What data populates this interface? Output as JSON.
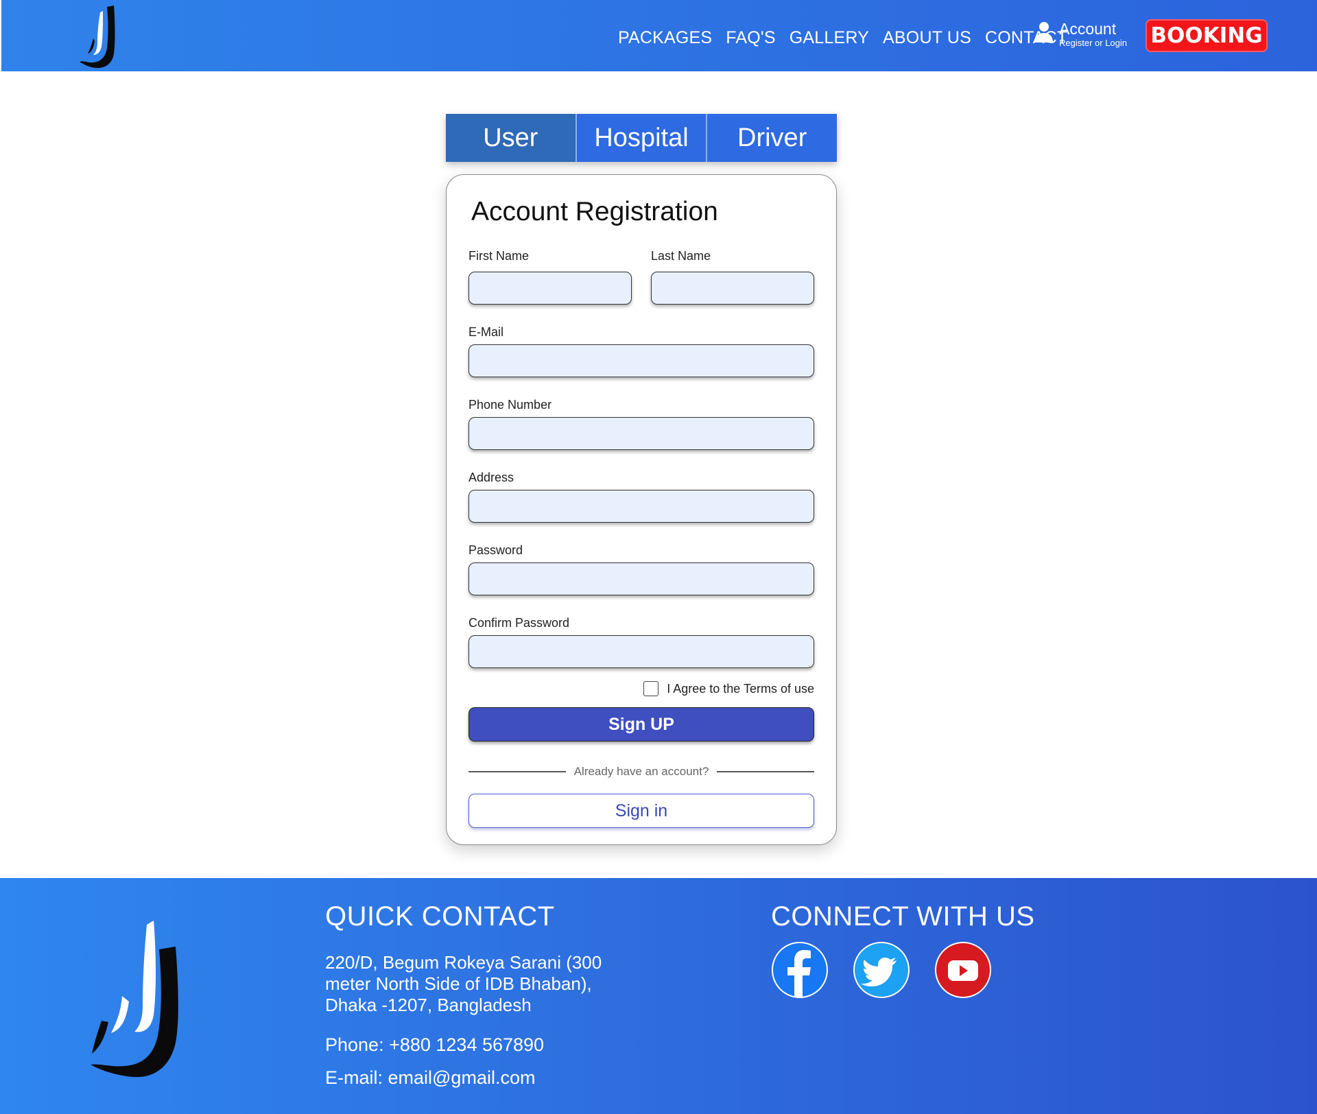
{
  "header": {
    "nav": [
      "PACKAGES",
      "FAQ'S",
      "GALLERY",
      "ABOUT US",
      "CONTACT"
    ],
    "account": {
      "title": "Account",
      "subtitle": "Register or Login"
    },
    "booking_label": "BOOKING"
  },
  "tabs": [
    {
      "label": "User",
      "active": true
    },
    {
      "label": "Hospital",
      "active": false
    },
    {
      "label": "Driver",
      "active": false
    }
  ],
  "form": {
    "title": "Account Registration",
    "fields": {
      "first_name": {
        "label": "First Name",
        "value": ""
      },
      "last_name": {
        "label": "Last Name",
        "value": ""
      },
      "email": {
        "label": "E-Mail",
        "value": ""
      },
      "phone": {
        "label": "Phone Number",
        "value": ""
      },
      "address": {
        "label": "Address",
        "value": ""
      },
      "password": {
        "label": "Password",
        "value": ""
      },
      "confirm_password": {
        "label": "Confirm Password",
        "value": ""
      }
    },
    "terms_label": "I Agree to the Terms of use",
    "terms_checked": false,
    "signup_label": "Sign UP",
    "divider_text": "Already have an account?",
    "signin_label": "Sign in"
  },
  "footer": {
    "quick_contact_title": "QUICK CONTACT",
    "address": "220/D, Begum Rokeya Sarani (300 meter North Side of IDB Bhaban), Dhaka -1207, Bangladesh",
    "phone": "Phone: +880 1234 567890",
    "email": "E-mail: email@gmail.com",
    "connect_title": "CONNECT WITH US",
    "social": [
      "facebook-icon",
      "twitter-icon",
      "youtube-icon"
    ]
  },
  "colors": {
    "header_gradient": [
      "#2f83ea",
      "#2c63dc"
    ],
    "booking": "#f2161b",
    "tab": "#2e6ae2",
    "tab_active": "#2f6ab8",
    "signup": "#3f4fc0",
    "input_bg": "#e8f0fe",
    "facebook": "#1877f2",
    "twitter": "#1da1f2",
    "youtube": "#d71920"
  }
}
